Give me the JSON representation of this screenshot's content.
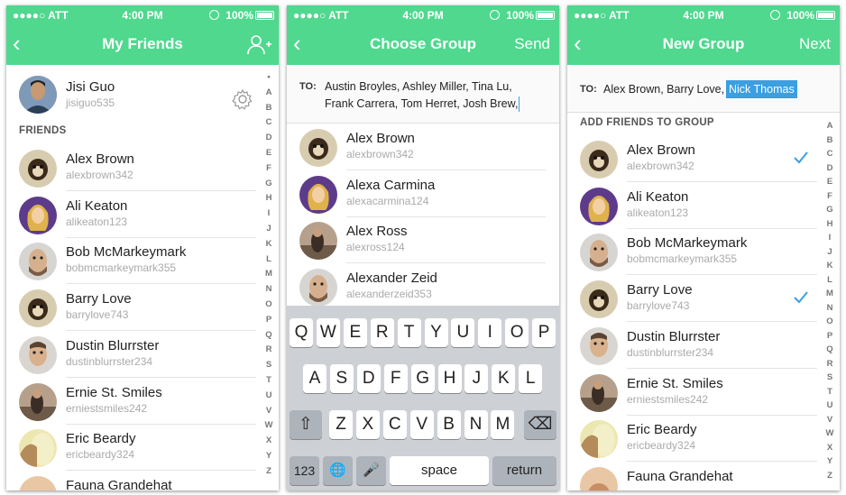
{
  "status": {
    "carrier": "●●●●○ ATT",
    "time": "4:00 PM",
    "battery": "100%"
  },
  "screen1": {
    "title": "My Friends",
    "back": "‹",
    "profile": {
      "name": "Jisi Guo",
      "username": "jisiguo535"
    },
    "section": "FRIENDS",
    "friends": [
      {
        "name": "Alex Brown",
        "username": "alexbrown342"
      },
      {
        "name": "Ali Keaton",
        "username": "alikeaton123"
      },
      {
        "name": "Bob McMarkeymark",
        "username": "bobmcmarkeymark355"
      },
      {
        "name": "Barry Love",
        "username": "barrylove743"
      },
      {
        "name": "Dustin Blurrster",
        "username": "dustinblurrster234"
      },
      {
        "name": "Ernie St. Smiles",
        "username": "erniestsmiles242"
      },
      {
        "name": "Eric Beardy",
        "username": "ericbeardy324"
      },
      {
        "name": "Fauna Grandehat",
        "username": ""
      }
    ],
    "index": [
      "•",
      "A",
      "B",
      "C",
      "D",
      "E",
      "F",
      "G",
      "H",
      "I",
      "J",
      "K",
      "L",
      "M",
      "N",
      "O",
      "P",
      "Q",
      "R",
      "S",
      "T",
      "U",
      "V",
      "W",
      "X",
      "Y",
      "Z"
    ]
  },
  "screen2": {
    "title": "Choose Group",
    "back": "‹",
    "right": "Send",
    "to_label": "TO:",
    "to_line1": "Austin Broyles, Ashley Miller, Tina Lu,",
    "to_line2": "Frank Carrera, Tom Herret, Josh Brew,",
    "results": [
      {
        "name": "Alex Brown",
        "username": "alexbrown342"
      },
      {
        "name": "Alexa Carmina",
        "username": "alexacarmina124"
      },
      {
        "name": "Alex Ross",
        "username": "alexross124"
      },
      {
        "name": "Alexander Zeid",
        "username": "alexanderzeid353"
      }
    ],
    "keyboard": {
      "row1": [
        "Q",
        "W",
        "E",
        "R",
        "T",
        "Y",
        "U",
        "I",
        "O",
        "P"
      ],
      "row2": [
        "A",
        "S",
        "D",
        "F",
        "G",
        "H",
        "J",
        "K",
        "L"
      ],
      "row3": [
        "Z",
        "X",
        "C",
        "V",
        "B",
        "N",
        "M"
      ],
      "shift": "⇧",
      "delete": "⌫",
      "numbers": "123",
      "globe": "🌐",
      "mic": "🎤",
      "space": "space",
      "return": "return"
    }
  },
  "screen3": {
    "title": "New Group",
    "back": "‹",
    "right": "Next",
    "to_label": "TO:",
    "to_names": "Alex Brown, Barry Love,",
    "to_highlight": "Nick Thomas",
    "section": "ADD FRIENDS TO GROUP",
    "friends": [
      {
        "name": "Alex Brown",
        "username": "alexbrown342",
        "checked": true
      },
      {
        "name": "Ali Keaton",
        "username": "alikeaton123",
        "checked": false
      },
      {
        "name": "Bob McMarkeymark",
        "username": "bobmcmarkeymark355",
        "checked": false
      },
      {
        "name": "Barry Love",
        "username": "barrylove743",
        "checked": true
      },
      {
        "name": "Dustin Blurrster",
        "username": "dustinblurrster234",
        "checked": false
      },
      {
        "name": "Ernie St. Smiles",
        "username": "erniestsmiles242",
        "checked": false
      },
      {
        "name": "Eric Beardy",
        "username": "ericbeardy324",
        "checked": false
      },
      {
        "name": "Fauna Grandehat",
        "username": "",
        "checked": false
      }
    ],
    "index": [
      "A",
      "B",
      "C",
      "D",
      "E",
      "F",
      "G",
      "H",
      "I",
      "J",
      "K",
      "L",
      "M",
      "N",
      "O",
      "P",
      "Q",
      "R",
      "S",
      "T",
      "U",
      "V",
      "W",
      "X",
      "Y",
      "Z"
    ]
  },
  "colors": {
    "accent": "#4fd88e",
    "check": "#3b9fe0",
    "highlight": "#3b9fe0"
  }
}
